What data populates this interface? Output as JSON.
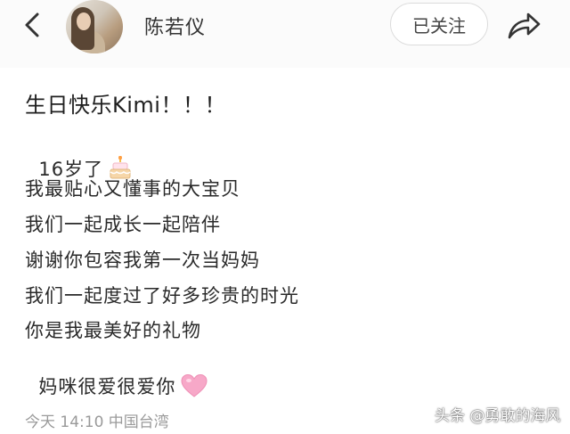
{
  "header": {
    "back_icon": "chevron-left-icon",
    "username": "陈若仪",
    "follow_label": "已关注",
    "share_icon": "share-arrow-icon"
  },
  "post": {
    "title": "生日快乐Kimi！！！",
    "lines": [
      "16岁了",
      "我最贴心又懂事的大宝贝",
      "我们一起成长一起陪伴",
      "谢谢你包容我第一次当妈妈",
      "我们一起度过了好多珍贵的时光",
      "你是我最美好的礼物",
      "妈咪很爱很爱你"
    ],
    "icons": [
      "birthday-cake-icon",
      "pink-heart-icon"
    ],
    "meta": "今天 14:10 中国台湾"
  },
  "watermark": "头条 @勇敢的海风",
  "colors": {
    "heart": "#f7a8c8",
    "meta_text": "#9a9a9a",
    "header_bg": "#fbfbfb"
  }
}
